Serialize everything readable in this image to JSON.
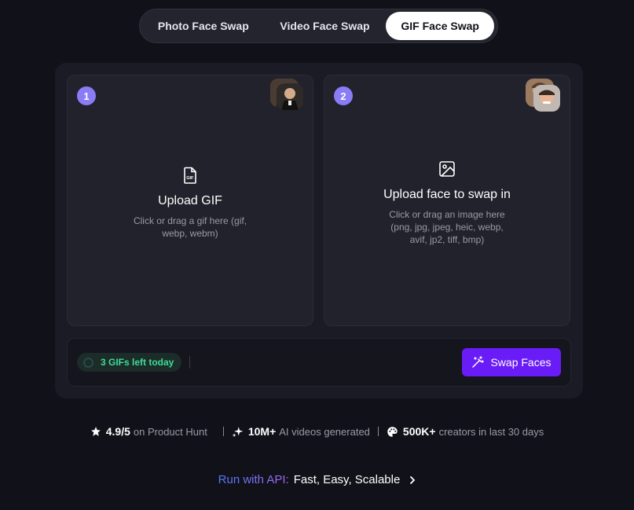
{
  "tabs": [
    {
      "label": "Photo Face Swap",
      "active": false
    },
    {
      "label": "Video Face Swap",
      "active": false
    },
    {
      "label": "GIF Face Swap",
      "active": true
    }
  ],
  "cards": [
    {
      "step": "1",
      "icon": "gif-file-icon",
      "title": "Upload GIF",
      "description": "Click or drag a gif here (gif, webp, webm)"
    },
    {
      "step": "2",
      "icon": "image-icon",
      "title": "Upload face to swap in",
      "description": "Click or drag an image here (png, jpg, jpeg, heic, webp, avif, jp2, tiff, bmp)"
    }
  ],
  "quota": {
    "text": "3 GIFs left today"
  },
  "swap_button": {
    "label": "Swap Faces",
    "icon": "magic-wand-icon"
  },
  "stats": [
    {
      "value": "4.9/5",
      "label": "on Product Hunt",
      "icon": "star-icon"
    },
    {
      "value": "10M+",
      "label": "AI videos generated",
      "icon": "sparkle-icon"
    },
    {
      "value": "500K+",
      "label": "creators in last 30 days",
      "icon": "palette-icon"
    }
  ],
  "api": {
    "label": "Run with API:",
    "text": "Fast, Easy, Scalable"
  },
  "colors": {
    "background": "#111119",
    "accent": "#6a1cf6",
    "step_badge": "#8a7cf5",
    "quota_text": "#3ddc97"
  }
}
